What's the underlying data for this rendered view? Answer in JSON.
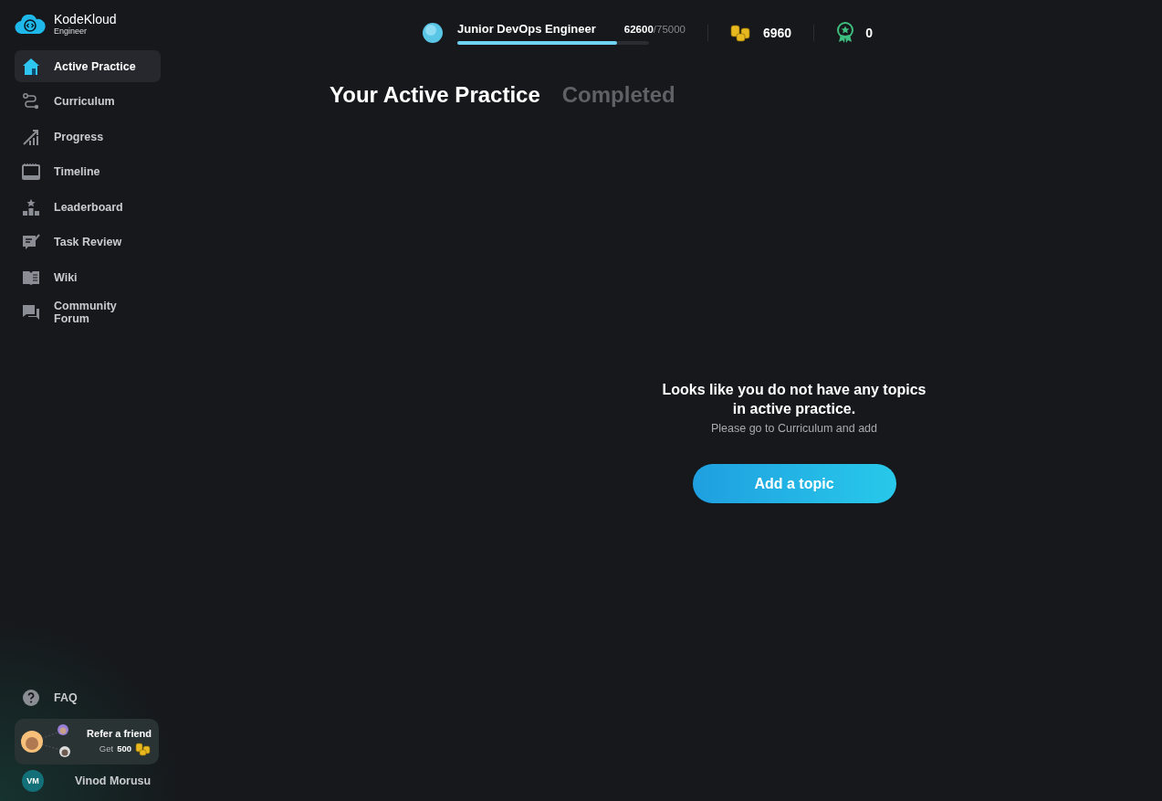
{
  "logo": {
    "name": "KodeKloud",
    "subtitle": "Engineer"
  },
  "nav": [
    {
      "label": "Active Practice",
      "kind": "home",
      "selected": true
    },
    {
      "label": "Curriculum",
      "kind": "route",
      "selected": false
    },
    {
      "label": "Progress",
      "kind": "growth",
      "selected": false
    },
    {
      "label": "Timeline",
      "kind": "calendar",
      "selected": false
    },
    {
      "label": "Leaderboard",
      "kind": "podium",
      "selected": false
    },
    {
      "label": "Task Review",
      "kind": "review",
      "selected": false
    },
    {
      "label": "Wiki",
      "kind": "book",
      "selected": false
    },
    {
      "label": "Community Forum",
      "kind": "chat",
      "selected": false
    }
  ],
  "faq": {
    "label": "FAQ"
  },
  "refer": {
    "title": "Refer a friend",
    "get": "Get",
    "amount": "500"
  },
  "user": {
    "initials": "VM",
    "name": "Vinod Morusu"
  },
  "rank": {
    "title": "Junior DevOps Engineer",
    "current": "62600",
    "total": "/75000",
    "level": 0.835
  },
  "coins": "6960",
  "badges": "0",
  "tabs": [
    {
      "label": "Your Active Practice",
      "selected": true
    },
    {
      "label": "Completed",
      "selected": false
    }
  ],
  "empty": {
    "title": "Looks like you do not have any topics in active practice.",
    "hint": "Please go to Curriculum and add",
    "button": "Add a topic"
  }
}
